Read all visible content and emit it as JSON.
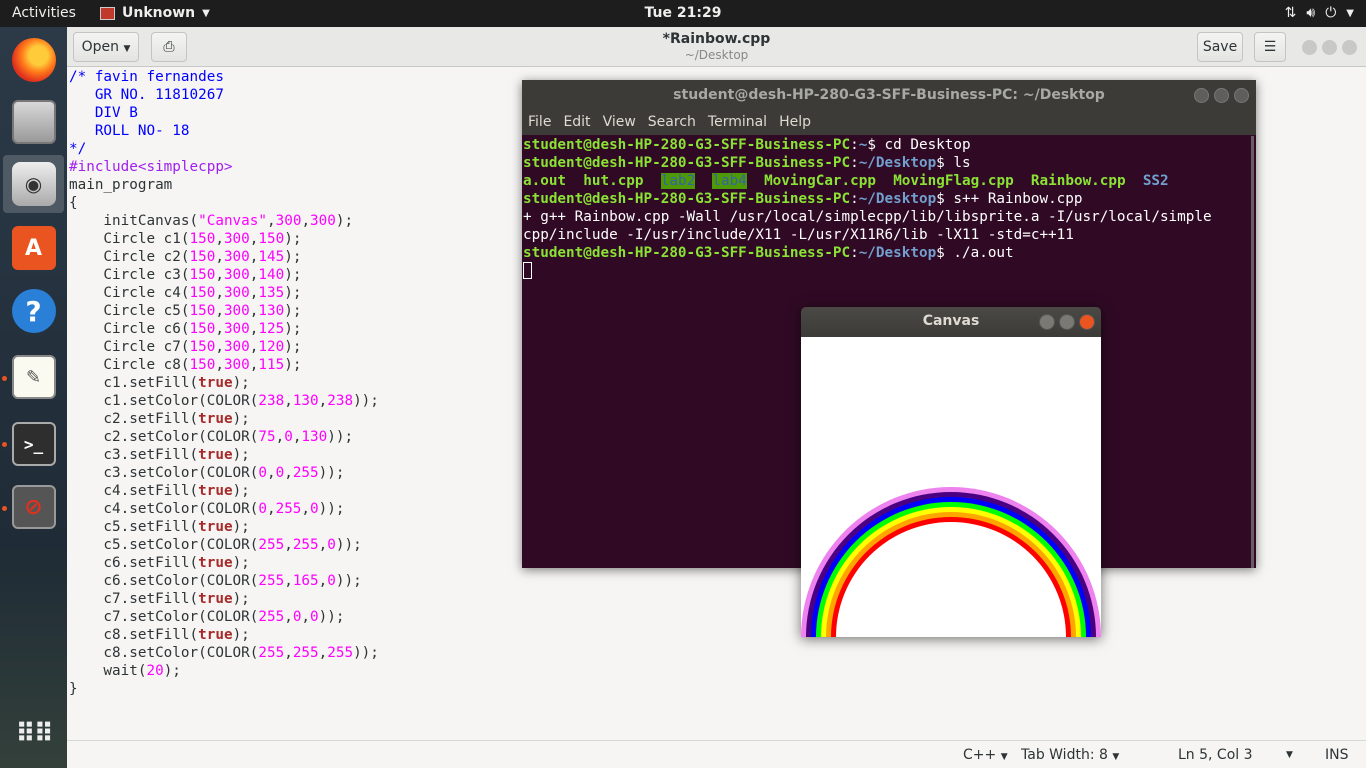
{
  "topbar": {
    "activities": "Activities",
    "app_name": "Unknown",
    "clock": "Tue 21:29"
  },
  "header": {
    "open_label": "Open",
    "title": "*Rainbow.cpp",
    "subtitle": "~/Desktop",
    "save_label": "Save"
  },
  "code": [
    "/* favin fernandes",
    "   GR NO. 11810267",
    "   DIV B",
    "   ROLL NO- 18",
    "*/",
    "#include<simplecpp>",
    "main_program",
    "{",
    "    initCanvas(\"Canvas\",300,300);",
    "    Circle c1(150,300,150);",
    "    Circle c2(150,300,145);",
    "    Circle c3(150,300,140);",
    "    Circle c4(150,300,135);",
    "    Circle c5(150,300,130);",
    "    Circle c6(150,300,125);",
    "    Circle c7(150,300,120);",
    "    Circle c8(150,300,115);",
    "    c1.setFill(true);",
    "    c1.setColor(COLOR(238,130,238));",
    "    c2.setFill(true);",
    "    c2.setColor(COLOR(75,0,130));",
    "    c3.setFill(true);",
    "    c3.setColor(COLOR(0,0,255));",
    "    c4.setFill(true);",
    "    c4.setColor(COLOR(0,255,0));",
    "    c5.setFill(true);",
    "    c5.setColor(COLOR(255,255,0));",
    "    c6.setFill(true);",
    "    c6.setColor(COLOR(255,165,0));",
    "    c7.setFill(true);",
    "    c7.setColor(COLOR(255,0,0));",
    "    c8.setFill(true);",
    "    c8.setColor(COLOR(255,255,255));",
    "    wait(20);",
    "}"
  ],
  "statusbar": {
    "language": "C++",
    "tab_width": "Tab Width: 8",
    "position": "Ln 5, Col 3",
    "mode": "INS"
  },
  "terminal": {
    "title": "student@desh-HP-280-G3-SFF-Business-PC: ~/Desktop",
    "menu": [
      "File",
      "Edit",
      "View",
      "Search",
      "Terminal",
      "Help"
    ],
    "prompt_user": "student@desh-HP-280-G3-SFF-Business-PC",
    "line1_path": "~",
    "line1_cmd": "$ cd Desktop",
    "line2_path": "~/Desktop",
    "line2_cmd": "$ ls",
    "ls_files": [
      "a.out",
      "hut.cpp",
      "lab2",
      "lab4",
      "MovingCar.cpp",
      "MovingFlag.cpp",
      "Rainbow.cpp",
      "SS2"
    ],
    "line4_cmd": "$ s++ Rainbow.cpp",
    "compile_line1": "+ g++ Rainbow.cpp -Wall /usr/local/simplecpp/lib/libsprite.a -I/usr/local/simple",
    "compile_line2": "cpp/include -I/usr/include/X11 -L/usr/X11R6/lib -lX11 -std=c++11",
    "line6_cmd": "$ ./a.out"
  },
  "canvas_window": {
    "title": "Canvas"
  },
  "colors": {
    "rainbow": [
      "#ee82ee",
      "#4b0082",
      "#0000ff",
      "#00ff00",
      "#ffff00",
      "#ffa500",
      "#ff0000",
      "#ffffff"
    ],
    "terminal_bg": "#300a24",
    "prompt_green": "#8ae234",
    "prompt_blue": "#729fcf"
  },
  "icons": [
    "firefox-icon",
    "files-icon",
    "camera-icon",
    "software-icon",
    "help-icon",
    "text-editor-icon",
    "terminal-icon",
    "blocked-app-icon",
    "show-apps-icon"
  ]
}
